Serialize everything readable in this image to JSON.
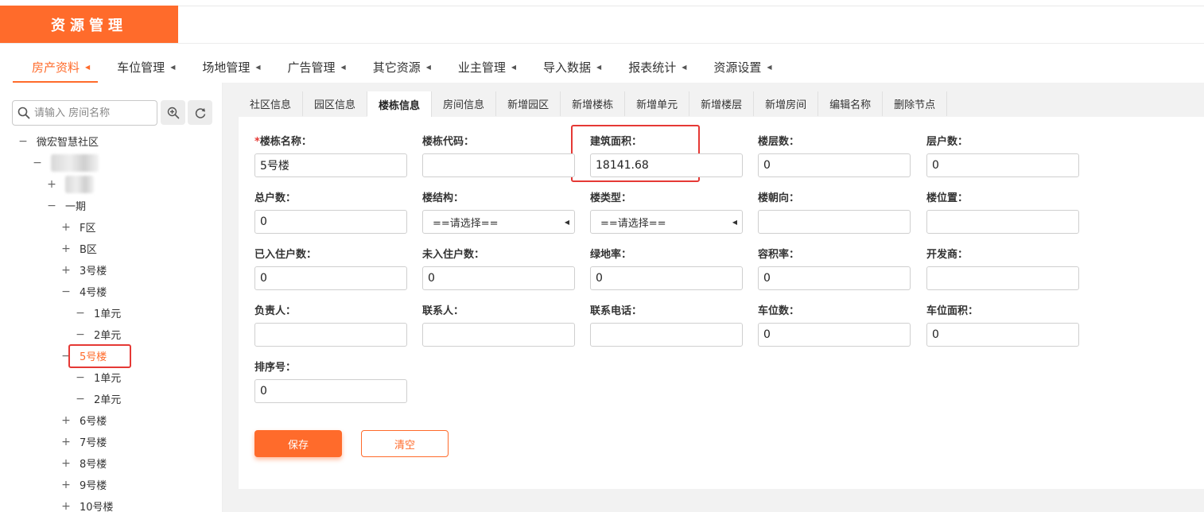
{
  "header": {
    "title": "资源管理"
  },
  "main_nav": [
    {
      "label": "房产资料",
      "active": true
    },
    {
      "label": "车位管理"
    },
    {
      "label": "场地管理"
    },
    {
      "label": "广告管理"
    },
    {
      "label": "其它资源"
    },
    {
      "label": "业主管理"
    },
    {
      "label": "导入数据"
    },
    {
      "label": "报表统计"
    },
    {
      "label": "资源设置"
    }
  ],
  "nav_arrow": "◀",
  "search": {
    "placeholder": "请输入 房间名称"
  },
  "icons": {
    "search": "search-icon",
    "zoom": "zoom-in-icon",
    "refresh": "refresh-icon"
  },
  "tree": [
    {
      "label": "微宏智慧社区",
      "toggle": "−",
      "level": 0
    },
    {
      "label": "",
      "toggle": "−",
      "level": 1,
      "blurred": true
    },
    {
      "label": "",
      "toggle": "+",
      "level": 2,
      "blurred": true
    },
    {
      "label": "一期",
      "toggle": "−",
      "level": 2
    },
    {
      "label": "F区",
      "toggle": "+",
      "level": 3
    },
    {
      "label": "B区",
      "toggle": "+",
      "level": 3
    },
    {
      "label": "3号楼",
      "toggle": "+",
      "level": 3
    },
    {
      "label": "4号楼",
      "toggle": "−",
      "level": 3
    },
    {
      "label": "1单元",
      "toggle": "−",
      "level": 4
    },
    {
      "label": "2单元",
      "toggle": "−",
      "level": 4
    },
    {
      "label": "5号楼",
      "toggle": "−",
      "level": 3,
      "selected": true
    },
    {
      "label": "1单元",
      "toggle": "−",
      "level": 4
    },
    {
      "label": "2单元",
      "toggle": "−",
      "level": 4
    },
    {
      "label": "6号楼",
      "toggle": "+",
      "level": 3
    },
    {
      "label": "7号楼",
      "toggle": "+",
      "level": 3
    },
    {
      "label": "8号楼",
      "toggle": "+",
      "level": 3
    },
    {
      "label": "9号楼",
      "toggle": "+",
      "level": 3
    },
    {
      "label": "10号楼",
      "toggle": "+",
      "level": 3
    }
  ],
  "tabs": [
    {
      "label": "社区信息"
    },
    {
      "label": "园区信息"
    },
    {
      "label": "楼栋信息",
      "active": true
    },
    {
      "label": "房间信息"
    },
    {
      "label": "新增园区"
    },
    {
      "label": "新增楼栋"
    },
    {
      "label": "新增单元"
    },
    {
      "label": "新增楼层"
    },
    {
      "label": "新增房间"
    },
    {
      "label": "编辑名称"
    },
    {
      "label": "删除节点"
    }
  ],
  "form": {
    "rows": [
      [
        {
          "label": "楼栋名称：",
          "required": true,
          "value": "5号楼",
          "type": "input"
        },
        {
          "label": "楼栋代码：",
          "value": "",
          "type": "input"
        },
        {
          "label": "建筑面积：",
          "value": "18141.68",
          "type": "input",
          "highlighted": true
        },
        {
          "label": "楼层数：",
          "value": "0",
          "type": "input"
        },
        {
          "label": "层户数：",
          "value": "0",
          "type": "input"
        }
      ],
      [
        {
          "label": "总户数：",
          "value": "0",
          "type": "input"
        },
        {
          "label": "楼结构：",
          "value": "==请选择==",
          "type": "select"
        },
        {
          "label": "楼类型：",
          "value": "==请选择==",
          "type": "select"
        },
        {
          "label": "楼朝向：",
          "value": "",
          "type": "input"
        },
        {
          "label": "楼位置：",
          "value": "",
          "type": "input"
        }
      ],
      [
        {
          "label": "已入住户数：",
          "value": "0",
          "type": "input"
        },
        {
          "label": "未入住户数：",
          "value": "0",
          "type": "input"
        },
        {
          "label": "绿地率：",
          "value": "0",
          "type": "input"
        },
        {
          "label": "容积率：",
          "value": "0",
          "type": "input"
        },
        {
          "label": "开发商：",
          "value": "",
          "type": "input"
        }
      ],
      [
        {
          "label": "负责人：",
          "value": "",
          "type": "input"
        },
        {
          "label": "联系人：",
          "value": "",
          "type": "input"
        },
        {
          "label": "联系电话：",
          "value": "",
          "type": "input"
        },
        {
          "label": "车位数：",
          "value": "0",
          "type": "input"
        },
        {
          "label": "车位面积：",
          "value": "0",
          "type": "input"
        }
      ],
      [
        {
          "label": "排序号：",
          "value": "0",
          "type": "input"
        }
      ]
    ],
    "required_mark": "*",
    "save_label": "保存",
    "clear_label": "清空"
  },
  "colors": {
    "accent": "#ff6b2b",
    "highlight": "#e53935"
  }
}
